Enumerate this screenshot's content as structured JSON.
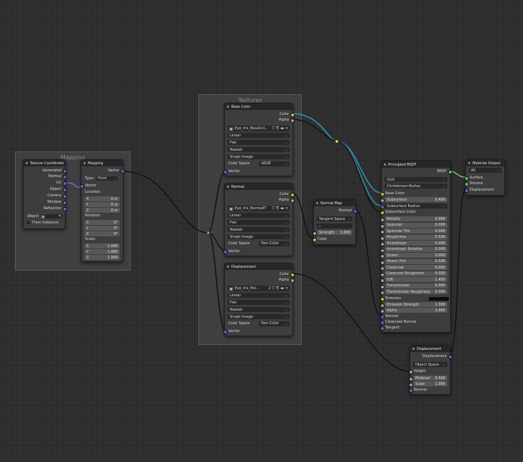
{
  "frames": {
    "mapping": "Mapping",
    "textures": "Textures"
  },
  "texcoord": {
    "title": "Texture Coordinate",
    "outputs": [
      "Generated",
      "Normal",
      "UV",
      "Object",
      "Camera",
      "Window",
      "Reflection"
    ],
    "object_label": "Object",
    "from_instancer": "From Instancer"
  },
  "mapping": {
    "title": "Mapping",
    "output": "Vector",
    "type_label": "Type:",
    "type_value": "Point",
    "vector": "Vector",
    "location": "Location:",
    "loc": [
      {
        "axis": "X",
        "value": "0 m"
      },
      {
        "axis": "Y",
        "value": "0 m"
      },
      {
        "axis": "Z",
        "value": "0 m"
      }
    ],
    "rotation": "Rotation:",
    "rot": [
      {
        "axis": "X",
        "value": "0°"
      },
      {
        "axis": "Y",
        "value": "0°"
      },
      {
        "axis": "Z",
        "value": "0°"
      }
    ],
    "scale": "Scale:",
    "scl": [
      {
        "axis": "X",
        "value": "1.000"
      },
      {
        "axis": "Y",
        "value": "1.000"
      },
      {
        "axis": "Z",
        "value": "1.000"
      }
    ]
  },
  "tex1": {
    "title": "Base Color",
    "out_color": "Color",
    "out_alpha": "Alpha",
    "image": "Eye_Iris_BaseCol...",
    "interp": "Linear",
    "proj": "Flat",
    "ext": "Repeat",
    "src": "Single Image",
    "cs_label": "Color Space",
    "cs_value": "sRGB",
    "vector": "Vector"
  },
  "tex2": {
    "title": "Normal",
    "out_color": "Color",
    "out_alpha": "Alpha",
    "image": "Eye_Iris_NormalIT",
    "interp": "Linear",
    "proj": "Flat",
    "ext": "Repeat",
    "src": "Single Image",
    "cs_label": "Color Space",
    "cs_value": "Non-Color",
    "vector": "Vector"
  },
  "tex3": {
    "title": "Displacement",
    "out_color": "Color",
    "out_alpha": "Alpha",
    "image": "Eye_Iris_Hei...",
    "users": "2",
    "interp": "Linear",
    "proj": "Flat",
    "ext": "Repeat",
    "src": "Single Image",
    "cs_label": "Color Space",
    "cs_value": "Non-Color",
    "vector": "Vector"
  },
  "normalmap": {
    "title": "Normal Map",
    "output": "Normal",
    "space": "Tangent Space",
    "strength_label": "Strength",
    "strength_value": "1.000",
    "color": "Color"
  },
  "bsdf": {
    "title": "Principled BSDF",
    "output": "BSDF",
    "dist": "GGX",
    "sss_method": "Christensen-Burley",
    "base_color": "Base Color",
    "subsurface": {
      "label": "Subsurface",
      "value": "0.400"
    },
    "subsurface_radius": "Subsurface Radius",
    "subsurface_color": "Subsurface Color",
    "params": [
      {
        "label": "Metallic",
        "value": "0.000"
      },
      {
        "label": "Specular",
        "value": "0.000"
      },
      {
        "label": "Specular Tint",
        "value": "0.000"
      },
      {
        "label": "Roughness",
        "value": "0.500"
      },
      {
        "label": "Anisotropic",
        "value": "0.000"
      },
      {
        "label": "Anisotropic Rotation",
        "value": "0.000"
      },
      {
        "label": "Sheen",
        "value": "0.000"
      },
      {
        "label": "Sheen Tint",
        "value": "0.500"
      },
      {
        "label": "Clearcoat",
        "value": "0.000"
      },
      {
        "label": "Clearcoat Roughness",
        "value": "0.030"
      },
      {
        "label": "IOR",
        "value": "1.450"
      },
      {
        "label": "Transmission",
        "value": "0.000"
      },
      {
        "label": "Transmission Roughness",
        "value": "0.000"
      }
    ],
    "emission": "Emission",
    "emission_strength": {
      "label": "Emission Strength",
      "value": "1.000"
    },
    "alpha": {
      "label": "Alpha",
      "value": "1.000"
    },
    "normal": "Normal",
    "clearcoat_normal": "Clearcoat Normal",
    "tangent": "Tangent"
  },
  "matout": {
    "title": "Material Output",
    "target": "All",
    "inputs": [
      "Surface",
      "Volume",
      "Displacement"
    ]
  },
  "disp": {
    "title": "Displacement",
    "output": "Displacement",
    "space": "Object Space",
    "height": "Height",
    "midlevel": {
      "label": "Midlevel",
      "value": "0.500"
    },
    "scale": {
      "label": "Scale",
      "value": "1.000"
    },
    "normal": "Normal"
  }
}
